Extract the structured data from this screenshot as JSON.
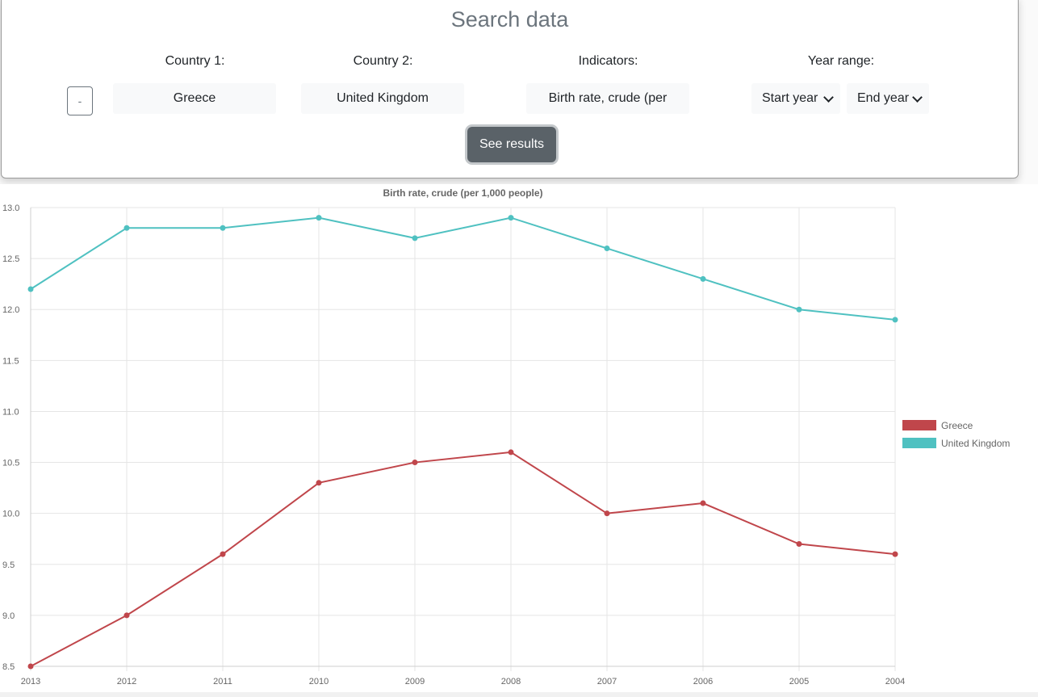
{
  "search": {
    "title": "Search data",
    "country1_label": "Country 1:",
    "country2_label": "Country 2:",
    "indicators_label": "Indicators:",
    "year_range_label": "Year range:",
    "remove_label": "-",
    "country1_value": "Greece",
    "country2_value": "United Kingdom",
    "indicator_value": "Birth rate, crude (per",
    "start_year_value": "Start year",
    "end_year_value": "End year",
    "submit_label": "See results"
  },
  "chart_data": {
    "type": "line",
    "title": "Birth rate, crude (per 1,000 people)",
    "xlabel": "",
    "ylabel": "",
    "categories": [
      "2013",
      "2012",
      "2011",
      "2010",
      "2009",
      "2008",
      "2007",
      "2006",
      "2005",
      "2004"
    ],
    "ylim": [
      8.5,
      13.0
    ],
    "yticks": [
      "13.0",
      "12.5",
      "12.0",
      "11.5",
      "11.0",
      "10.5",
      "10.0",
      "9.5",
      "9.0",
      "8.5"
    ],
    "grid": true,
    "legend_position": "right",
    "series": [
      {
        "name": "Greece",
        "color": "#c0464b",
        "values": [
          8.5,
          9.0,
          9.6,
          10.3,
          10.5,
          10.6,
          10.0,
          10.1,
          9.7,
          9.6
        ]
      },
      {
        "name": "United Kingdom",
        "color": "#4fc1c1",
        "values": [
          12.2,
          12.8,
          12.8,
          12.9,
          12.7,
          12.9,
          12.6,
          12.3,
          12.0,
          11.9
        ]
      }
    ]
  }
}
